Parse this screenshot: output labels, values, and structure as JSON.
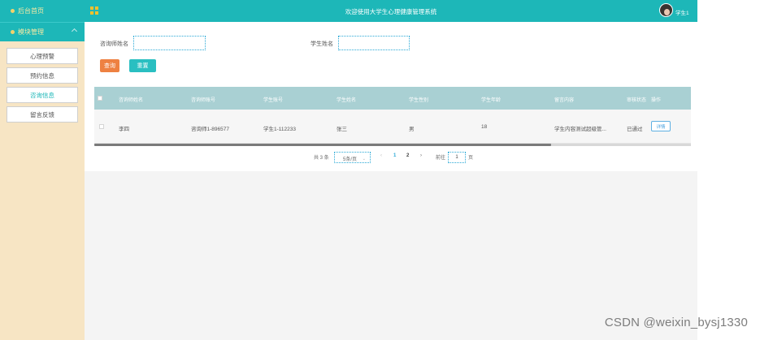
{
  "sidebar": {
    "home_label": "后台首页",
    "module_label": "模块管理",
    "items": [
      {
        "label": "心理预警",
        "active": false
      },
      {
        "label": "预约信息",
        "active": false
      },
      {
        "label": "咨询信息",
        "active": true
      },
      {
        "label": "留言反馈",
        "active": false
      }
    ]
  },
  "header": {
    "title": "欢迎使用大学生心理健康管理系统",
    "user": "学生1"
  },
  "search": {
    "consultant_label": "咨询师姓名",
    "consultant_value": "",
    "student_label": "学生姓名",
    "student_value": "",
    "query_label": "查询",
    "reset_label": "重置"
  },
  "table": {
    "headers": [
      "咨询师姓名",
      "咨询师账号",
      "学生账号",
      "学生姓名",
      "学生性别",
      "学生年龄",
      "留言内容",
      "审核状态",
      "操作"
    ],
    "rows": [
      {
        "consultant_name": "李四",
        "consultant_account": "咨询师1-896577",
        "student_account": "学生1-112233",
        "student_name": "张三",
        "gender": "男",
        "age": "18",
        "message": "学生内容测试超级管...",
        "status": "已通过",
        "action": "详情"
      }
    ]
  },
  "pagination": {
    "total": "共 3 条",
    "page_size": "5条/页",
    "prev": "‹",
    "pages": [
      "1",
      "2"
    ],
    "current_page": "1",
    "next": "›",
    "goto_label": "前往",
    "goto_value": "1",
    "page_suffix": "页"
  },
  "colors": {
    "teal": "#1db7b8",
    "sidebar_bg": "#f7e5c4",
    "query": "#ee8142",
    "reset": "#2abfc1",
    "table_header": "#a9d0d3"
  },
  "watermark": "CSDN @weixin_bysj1330"
}
